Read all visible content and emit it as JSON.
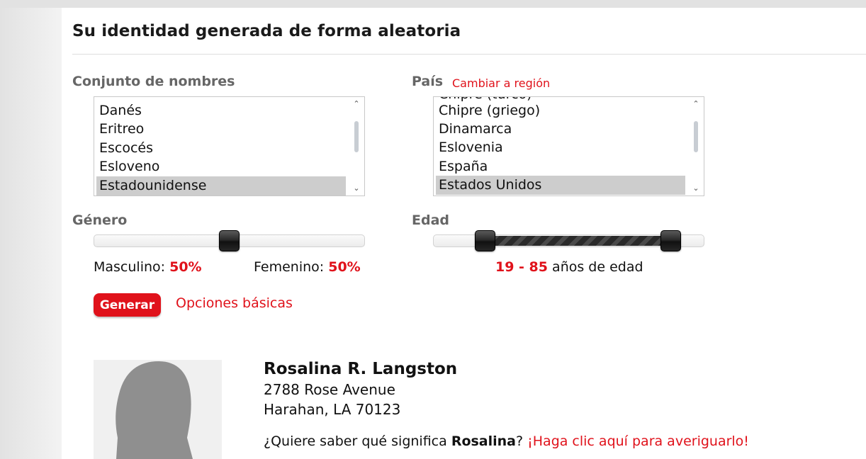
{
  "page": {
    "title": "Su identidad generada de forma aleatoria"
  },
  "name_set": {
    "label": "Conjunto de nombres",
    "options": [
      "Danés",
      "Eritreo",
      "Escocés",
      "Esloveno",
      "Estadounidense"
    ],
    "selected": "Estadounidense"
  },
  "country": {
    "label": "País",
    "switch_link": "Cambiar a región",
    "options": [
      "Chipre (turco)",
      "Chipre (griego)",
      "Dinamarca",
      "Eslovenia",
      "España",
      "Estados Unidos"
    ],
    "selected": "Estados Unidos"
  },
  "gender": {
    "label": "Género",
    "male_label": "Masculino:",
    "male_value": "50%",
    "female_label": "Femenino:",
    "female_value": "50%",
    "female_fraction": 0.5
  },
  "age": {
    "label": "Edad",
    "range_text": "19 - 85",
    "suffix": "años de edad",
    "min": 19,
    "max": 85
  },
  "actions": {
    "generate": "Generar",
    "basic_options": "Opciones básicas"
  },
  "identity": {
    "avatar": "female-silhouette",
    "full_name": "Rosalina R. Langston",
    "street": "2788 Rose Avenue",
    "city_line": "Harahan, LA 70123",
    "meaning_prefix": "¿Quiere saber qué significa",
    "first_name": "Rosalina",
    "meaning_qmark": "?",
    "meaning_link": "¡Haga clic aquí para averiguarlo!"
  },
  "colors": {
    "accent": "#e0121b",
    "label_gray": "#666666"
  }
}
